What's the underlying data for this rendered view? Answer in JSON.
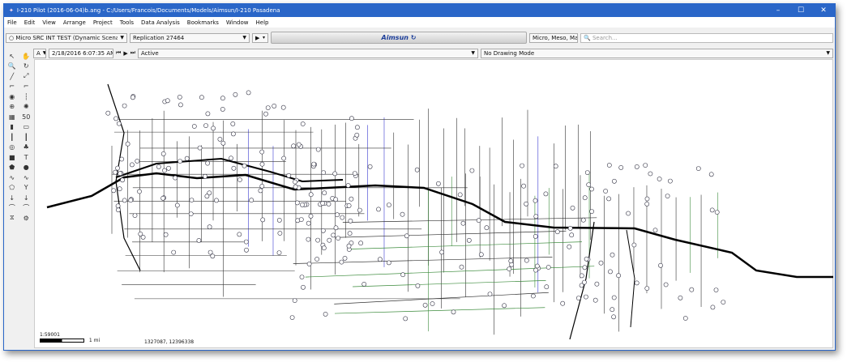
{
  "window": {
    "title": "I-210 Pilot (2016-06-04)b.ang - C:/Users/Francois/Documents/Models/Aimsun/I-210 Pasadena",
    "controls": [
      "–",
      "☐",
      "✕"
    ]
  },
  "menu": [
    "File",
    "Edit",
    "View",
    "Arrange",
    "Project",
    "Tools",
    "Data Analysis",
    "Bookmarks",
    "Window",
    "Help"
  ],
  "toolbar": {
    "scenario": "Micro SRC INT TEST (Dynamic Scenario INT TEST",
    "replication": "Replication 27464",
    "logo": "Aimsun",
    "mode": "Micro, Meso, Macro",
    "search_placeholder": "Search..."
  },
  "timebar": {
    "letter": "A",
    "datetime": "2/18/2016 6:07:35 AM",
    "state": "Active",
    "drawing_mode": "No Drawing Mode"
  },
  "status": {
    "scale": "1:59001",
    "scale_unit": "1 mi",
    "coordinates": "1327087, 12396338"
  },
  "colors": {
    "titlebar": "#2a66c8",
    "freeway": "#000000",
    "arterial_blue": "#3a3ad0",
    "arterial_green": "#3a8a3a"
  }
}
